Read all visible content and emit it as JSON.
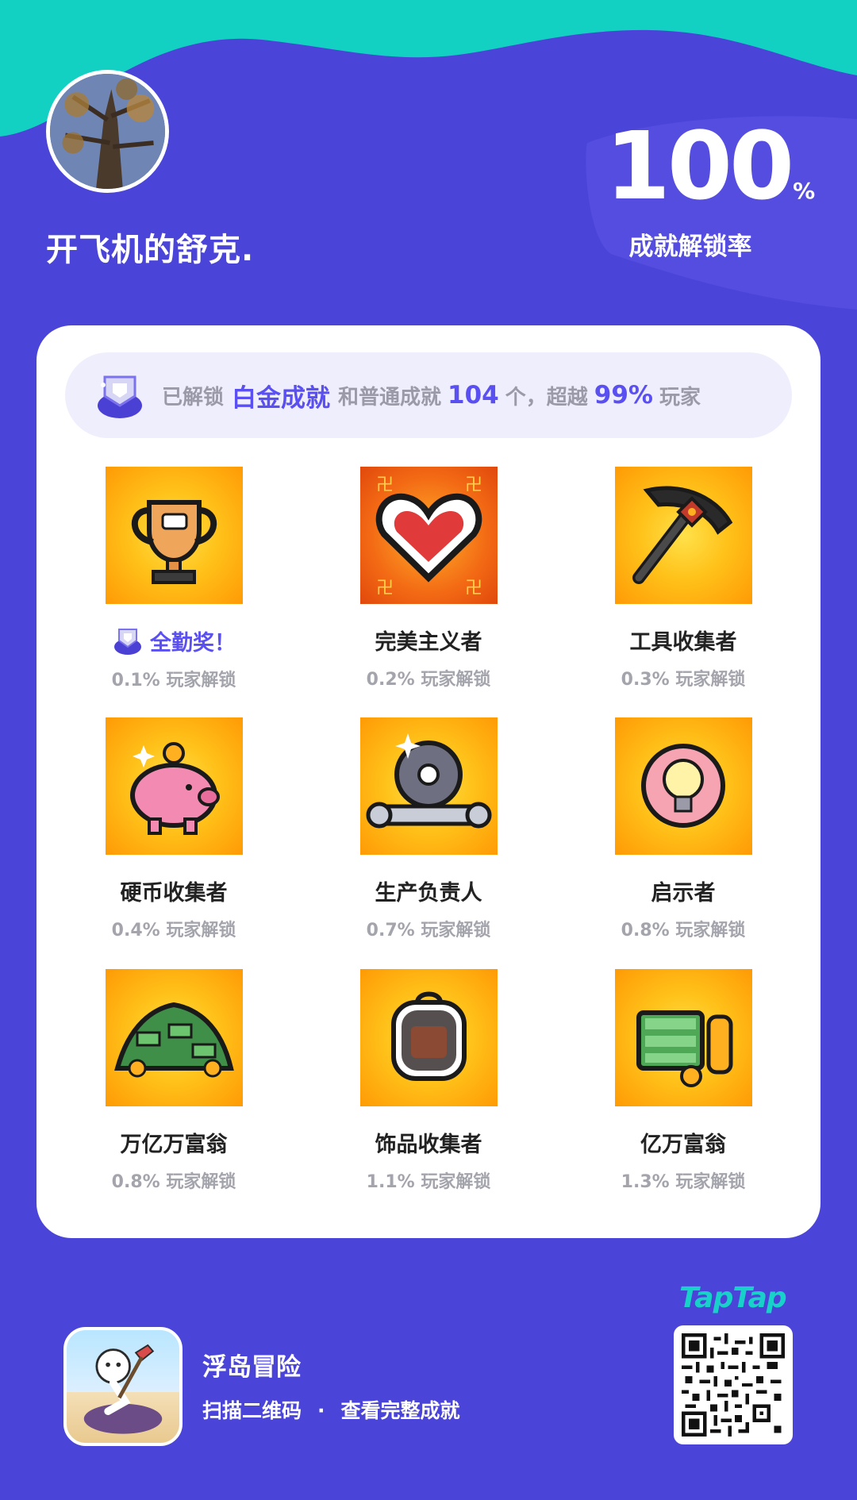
{
  "profile": {
    "username": "开飞机的舒克.",
    "rate_value": "100",
    "rate_unit": "%",
    "rate_label": "成就解锁率"
  },
  "summary": {
    "prefix": "已解锁",
    "platinum": "白金成就",
    "middle": "和普通成就",
    "count": "104",
    "count_unit": "个，超越",
    "percent": "99%",
    "suffix": "玩家"
  },
  "achievements": [
    {
      "name": "全勤奖！",
      "rate": "0.1% 玩家解锁",
      "icon": "trophy-icon",
      "platinum": true
    },
    {
      "name": "完美主义者",
      "rate": "0.2% 玩家解锁",
      "icon": "heart-icon"
    },
    {
      "name": "工具收集者",
      "rate": "0.3% 玩家解锁",
      "icon": "pickaxe-icon"
    },
    {
      "name": "硬币收集者",
      "rate": "0.4% 玩家解锁",
      "icon": "piggy-bank-icon"
    },
    {
      "name": "生产负责人",
      "rate": "0.7% 玩家解锁",
      "icon": "wrench-gear-icon"
    },
    {
      "name": "启示者",
      "rate": "0.8% 玩家解锁",
      "icon": "lightbulb-icon"
    },
    {
      "name": "万亿万富翁",
      "rate": "0.8% 玩家解锁",
      "icon": "money-pile-icon"
    },
    {
      "name": "饰品收集者",
      "rate": "1.1% 玩家解锁",
      "icon": "backpack-icon"
    },
    {
      "name": "亿万富翁",
      "rate": "1.3% 玩家解锁",
      "icon": "cash-coins-icon"
    }
  ],
  "footer": {
    "app_name": "浮岛冒险",
    "cta_left": "扫描二维码",
    "cta_dot": "·",
    "cta_right": "查看完整成就",
    "brand": "TapTap"
  },
  "colors": {
    "background": "#4b44d9",
    "teal": "#18d1c8",
    "accent": "#5a4ff0",
    "tile_orange": "#ff9a05"
  }
}
